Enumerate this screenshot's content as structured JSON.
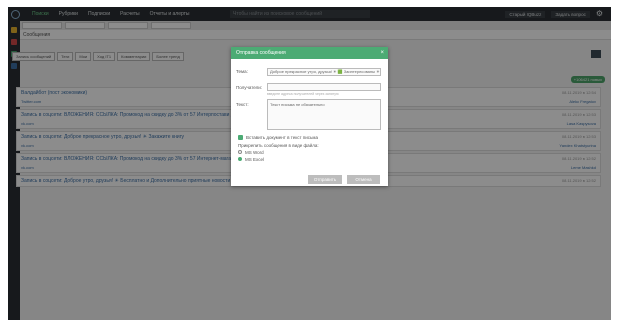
{
  "topbar": {
    "nav": [
      "Поиски",
      "Рубрики",
      "Подписки",
      "Расчеты",
      "Отчеты и алерты"
    ],
    "search_placeholder": "Чтобы найти из поисковое сообщений",
    "right": [
      "Старый IQBuzz",
      "Задать вопрос"
    ]
  },
  "content": {
    "query": "Сообщения",
    "toolbar": [
      "Запись сообщений",
      "Теги",
      "Мои",
      "Ход IT1",
      "Комментарии",
      "Более тренд"
    ],
    "count_badge": "+106421 новых"
  },
  "posts": [
    {
      "title": "Валдайбот (пост экономики)",
      "date": "08.11.2019 в 12:54",
      "meta_left": "Twitter.com",
      "meta_right": "Alekc Fregatov"
    },
    {
      "title": "Запись в соцсети: ВЛОЖЕНИЯ: ССЫЛКА: Промокод на скидку до 3% от 57 Интерпостави до",
      "date": "08.11.2019 в 12:53",
      "meta_left": "vk.com",
      "meta_right": "Lasa Kaspysova"
    },
    {
      "title": "Запись в соцсети: Доброе прекрасное утро, друзья! ☀ Закажите книгу",
      "date": "08.11.2019 в 12:53",
      "meta_left": "vk.com",
      "meta_right": "Yandex Khatstyurina"
    },
    {
      "title": "Запись в соцсети: ВЛОЖЕНИЯ: ССЫЛКА: Промокод на скидку до 3% от 57 Интернет-магазин Воровского для друзе...",
      "date": "08.11.2019 в 12:52",
      "meta_left": "vk.com",
      "meta_right": "Leme Mashkd"
    },
    {
      "title": "Запись в соцсети: Доброе утро, друзья! ☀ Бесплатно и Дополнительно приятные новости Метро: 7/8 Санкт-Петербурга начать...",
      "date": "08.11.2019 в 12:52",
      "meta_left": "",
      "meta_right": ""
    }
  ],
  "modal": {
    "title": "Отправка сообщения",
    "close": "×",
    "fields": {
      "subject_label": "Тема:",
      "subject_value": "Доброе прекрасное утро, друзья! ☀ 🟩 Заинтересованы ☀",
      "recipient_label": "Получатели:",
      "recipient_hint": "введите адреса получателей через запятую",
      "text_label": "Текст:",
      "text_value": "Текст письма не обязательно"
    },
    "checkbox_label": "Вставить документ в текст письма",
    "attach_label": "Прикрепить сообщения в виде файла:",
    "options": [
      "MS Word",
      "MS Excel"
    ],
    "send": "Отправить",
    "cancel": "Отмена"
  },
  "colors": {
    "accent": "#4cab74",
    "topbar": "#2b2f33"
  }
}
